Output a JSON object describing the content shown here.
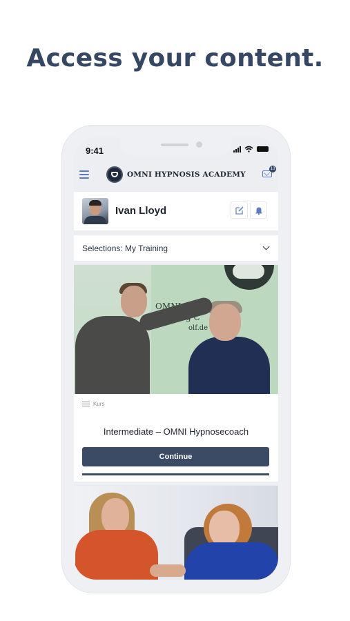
{
  "headline": "Access your content.",
  "status_bar": {
    "time": "9:41"
  },
  "app_bar": {
    "brand": "OMNI HYPNOSIS ACADEMY",
    "mail_badge": "10"
  },
  "profile": {
    "name": "Ivan Lloyd"
  },
  "selector": {
    "label": "Selections:  My Training"
  },
  "courses": [
    {
      "type": "Kurs",
      "title": "Intermediate – OMNI Hypnosecoach",
      "button": "Continue",
      "progress": 1.0,
      "image_sign": [
        "OMNI Hypno",
        "Training C",
        "olf.de"
      ]
    }
  ],
  "icons": {
    "menu": "hamburger-menu-icon",
    "mail": "envelope-icon",
    "edit": "edit-icon",
    "bell": "bell-icon",
    "chevron": "chevron-down-icon",
    "list": "list-icon"
  },
  "colors": {
    "headline": "#354763",
    "button": "#3b4b66",
    "accent": "#5b7cc0"
  }
}
